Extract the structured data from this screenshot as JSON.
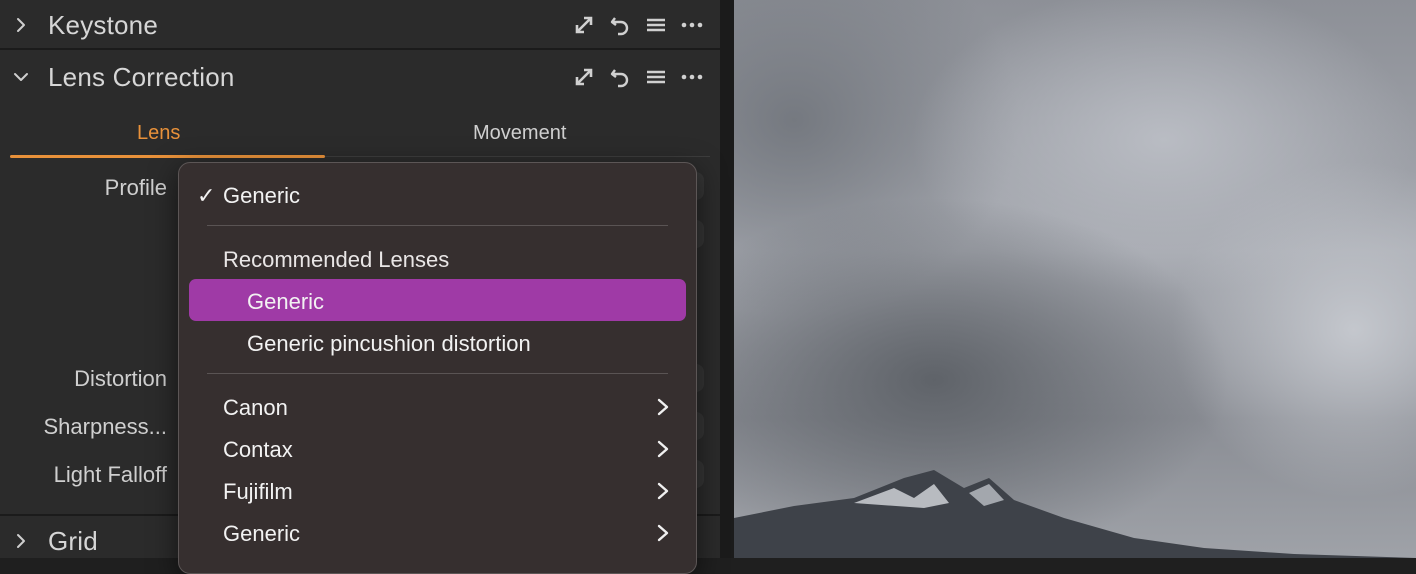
{
  "sections": {
    "keystone": {
      "title": "Keystone"
    },
    "lens_correction": {
      "title": "Lens Correction"
    },
    "grid": {
      "title": "Grid"
    }
  },
  "tabs": [
    {
      "label": "Lens",
      "active": true
    },
    {
      "label": "Movement",
      "active": false
    }
  ],
  "rows": {
    "profile": "Profile",
    "distortion": "Distortion",
    "sharpness": "Sharpness...",
    "light_falloff": "Light Falloff"
  },
  "menu": {
    "selected": "Generic",
    "group_header": "Recommended Lenses",
    "recommended": [
      "Generic",
      "Generic pincushion distortion"
    ],
    "highlighted_item": "Generic",
    "brands": [
      "Canon",
      "Contax",
      "Fujifilm",
      "Generic"
    ]
  },
  "colors": {
    "accent": "#e8913a",
    "highlight": "#9f3aa6",
    "panel_bg": "#2b2b2b",
    "menu_bg": "#362f2f"
  },
  "icons": [
    "chevron-right-icon",
    "chevron-down-icon",
    "expand-icon",
    "reset-icon",
    "list-icon",
    "more-icon",
    "checkmark-icon",
    "submenu-arrow-icon"
  ]
}
